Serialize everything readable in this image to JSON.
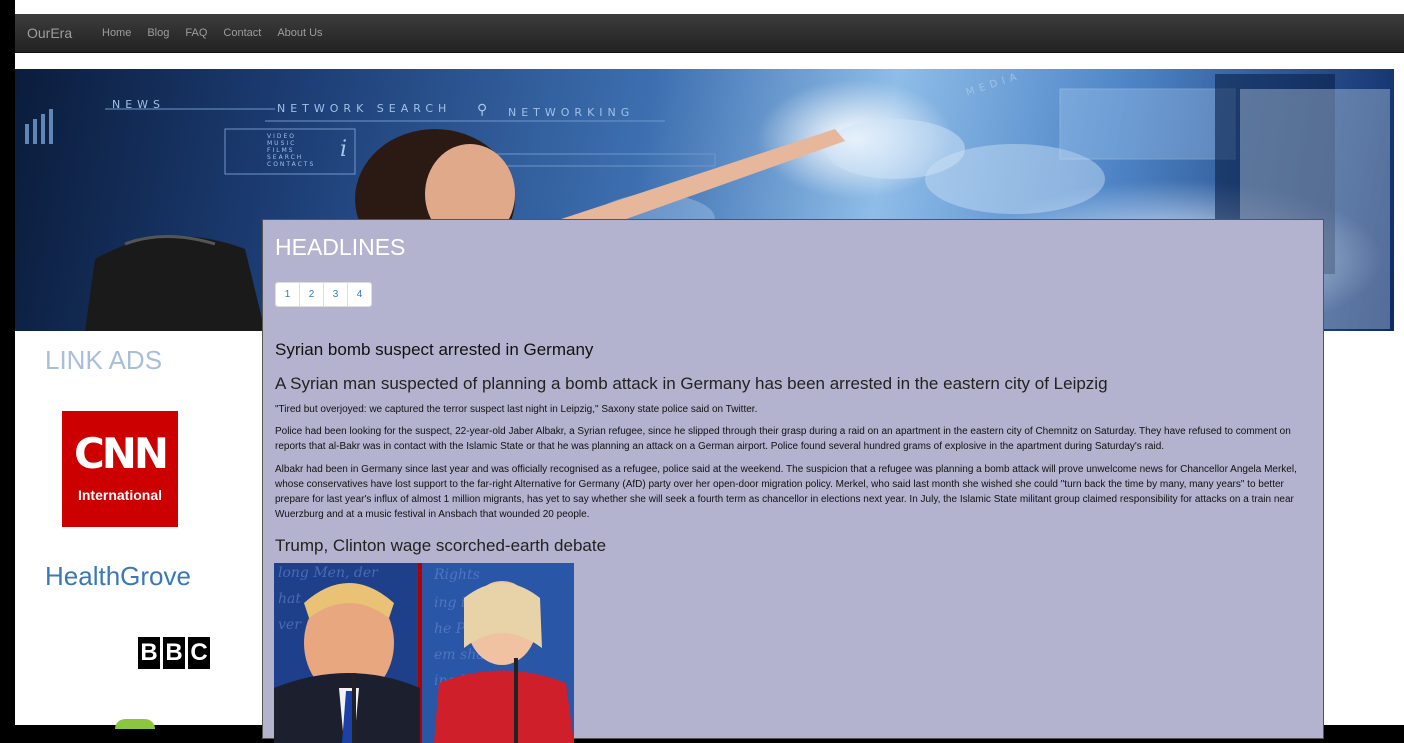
{
  "nav": {
    "brand": "OurEra",
    "links": [
      "Home",
      "Blog",
      "FAQ",
      "Contact",
      "About Us"
    ]
  },
  "banner": {
    "news_text": "NEWS",
    "network_text": "NETWORK SEARCH",
    "networking_text": "NETWORKING",
    "menu_text": "VIDEO MUSIC FILMS SEARCH CONTACTS",
    "media_text": "MEDIA"
  },
  "sidebar": {
    "title": "LINK ADS",
    "cnn_main": "CNN",
    "cnn_sub": "International",
    "healthgrove": "HealthGrove",
    "bbc": [
      "B",
      "B",
      "C"
    ]
  },
  "main": {
    "title": "HEADLINES",
    "pages": [
      "1",
      "2",
      "3",
      "4"
    ],
    "article1": {
      "title": "Syrian bomb suspect arrested in Germany",
      "subtitle": "A Syrian man suspected of planning a bomb attack in Germany has been arrested in the eastern city of Leipzig",
      "p1": "\"Tired but overjoyed: we captured the terror suspect last night in Leipzig,\" Saxony state police said on Twitter.",
      "p2": "Police had been looking for the suspect, 22-year-old Jaber Albakr, a Syrian refugee, since he slipped through their grasp during a raid on an apartment in the eastern city of Chemnitz on Saturday. They have refused to comment on reports that al-Bakr was in contact with the Islamic State or that he was planning an attack on a German airport. Police found several hundred grams of explosive in the apartment during Saturday's raid.",
      "p3": "Albakr had been in Germany since last year and was officially recognised as a refugee, police said at the weekend. The suspicion that a refugee was planning a bomb attack will prove unwelcome news for Chancellor Angela Merkel, whose conservatives have lost support to the far-right Alternative for Germany (AfD) party over her open-door migration policy. Merkel, who said last month she wished she could \"turn back the time by many, many years\" to better prepare for last year's influx of almost 1 million migrants, has yet to say whether she will seek a fourth term as chancellor in elections next year. In July, the Islamic State militant group claimed responsibility for attacks on a train near Wuerzburg and at a music festival in Ansbach that wounded 20 people."
    },
    "article2": {
      "title": "Trump, Clinton wage scorched-earth debate"
    }
  }
}
